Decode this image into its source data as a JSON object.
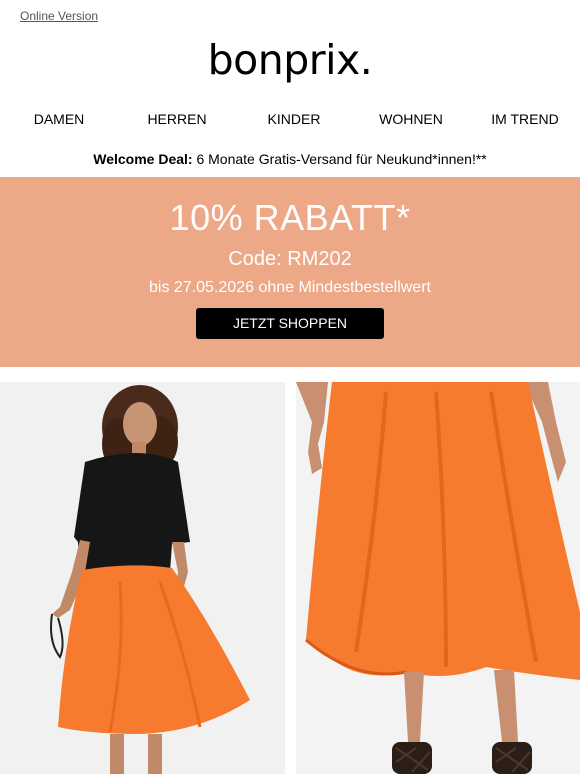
{
  "header": {
    "online_version": "Online Version",
    "logo": "bonprix."
  },
  "nav": {
    "items": [
      {
        "label": "DAMEN"
      },
      {
        "label": "HERREN"
      },
      {
        "label": "KINDER"
      },
      {
        "label": "WOHNEN"
      },
      {
        "label": "IM TREND"
      }
    ]
  },
  "welcome": {
    "bold": "Welcome Deal:",
    "text": " 6 Monate Gratis-Versand für Neukund*innen!**"
  },
  "promo": {
    "title": "10% RABATT*",
    "code": "Code: RM202",
    "validity": "bis 27.05.2026 ohne Mindestbestellwert",
    "cta": "JETZT SHOPPEN",
    "background": "#eda888",
    "button_color": "#000000"
  },
  "images": {
    "left": {
      "subject": "woman-in-orange-skirt-photo"
    },
    "right": {
      "subject": "orange-skirt-closeup-photo"
    },
    "accent": "#f77b2e"
  }
}
